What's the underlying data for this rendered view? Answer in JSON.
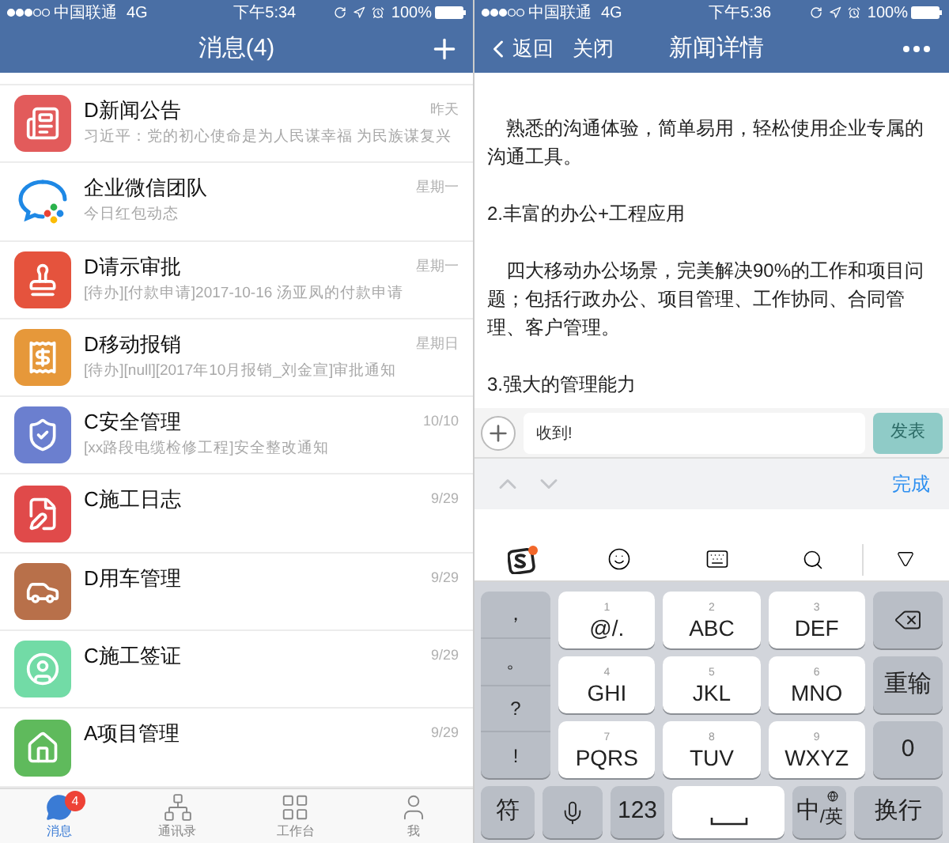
{
  "left": {
    "status_bar": {
      "carrier": "中国联通",
      "network": "4G",
      "time": "下午5:34",
      "battery": "100%"
    },
    "nav": {
      "title": "消息(4)"
    },
    "messages": [
      {
        "kind": "news",
        "title": "D新闻公告",
        "preview": "习近平：党的初心使命是为人民谋幸福 为民族谋复兴",
        "time": "昨天"
      },
      {
        "kind": "wecom",
        "title": "企业微信团队",
        "preview": "今日红包动态",
        "time": "星期一"
      },
      {
        "kind": "approval",
        "title": "D请示审批",
        "preview": "[待办][付款申请]2017-10-16 汤亚凤的付款申请",
        "time": "星期一"
      },
      {
        "kind": "expense",
        "title": "D移动报销",
        "preview": "[待办][null][2017年10月报销_刘金宣]审批通知",
        "time": "星期日"
      },
      {
        "kind": "safety",
        "title": "C安全管理",
        "preview": "[xx路段电缆检修工程]安全整改通知",
        "time": "10/10"
      },
      {
        "kind": "log",
        "title": "C施工日志",
        "time": "9/29"
      },
      {
        "kind": "car",
        "title": "D用车管理",
        "time": "9/29"
      },
      {
        "kind": "visa",
        "title": "C施工签证",
        "time": "9/29"
      },
      {
        "kind": "project",
        "title": "A项目管理",
        "time": "9/29"
      }
    ],
    "tabs": [
      {
        "kind": "chat",
        "label": "消息",
        "selected": true,
        "badge": "4"
      },
      {
        "kind": "contacts",
        "label": "通讯录",
        "selected": false
      },
      {
        "kind": "workbench",
        "label": "工作台",
        "selected": false
      },
      {
        "kind": "me",
        "label": "我",
        "selected": false
      }
    ]
  },
  "right": {
    "status_bar": {
      "carrier": "中国联通",
      "network": "4G",
      "time": "下午5:36",
      "battery": "100%"
    },
    "nav": {
      "back": "返回",
      "close": "关闭",
      "title": "新闻详情"
    },
    "article": [
      {
        "kind": "paragraph",
        "text": "熟悉的沟通体验，简单易用，轻松使用企业专属的沟通工具。"
      },
      {
        "kind": "heading",
        "text": "2.丰富的办公+工程应用"
      },
      {
        "kind": "paragraph",
        "text": "四大移动办公场景，完美解决90%的工作和项目问题；包括行政办公、项目管理、工作协同、合同管理、客户管理。"
      },
      {
        "kind": "heading",
        "text": "3.强大的管理能力"
      }
    ],
    "composer": {
      "value": "收到!",
      "send": "发表"
    },
    "toolbar": {
      "done": "完成"
    },
    "keyboard": {
      "punctuation": [
        "，",
        "。",
        "?",
        "!"
      ],
      "keys": [
        {
          "digit": "1",
          "letters": "@/."
        },
        {
          "digit": "2",
          "letters": "ABC"
        },
        {
          "digit": "3",
          "letters": "DEF"
        },
        {
          "digit": "4",
          "letters": "GHI"
        },
        {
          "digit": "5",
          "letters": "JKL"
        },
        {
          "digit": "6",
          "letters": "MNO"
        },
        {
          "digit": "7",
          "letters": "PQRS"
        },
        {
          "digit": "8",
          "letters": "TUV"
        },
        {
          "digit": "9",
          "letters": "WXYZ"
        }
      ],
      "side": [
        {
          "kind": "backspace"
        },
        {
          "kind": "text",
          "label": "重输"
        },
        {
          "kind": "text",
          "label": "0"
        }
      ],
      "bottom": [
        {
          "kind": "text",
          "label": "符"
        },
        {
          "kind": "mic"
        },
        {
          "kind": "text",
          "label": "123"
        },
        {
          "kind": "space"
        },
        {
          "kind": "lang",
          "label": "中$_{/英}$"
        },
        {
          "kind": "text",
          "label": "换行"
        }
      ]
    }
  }
}
